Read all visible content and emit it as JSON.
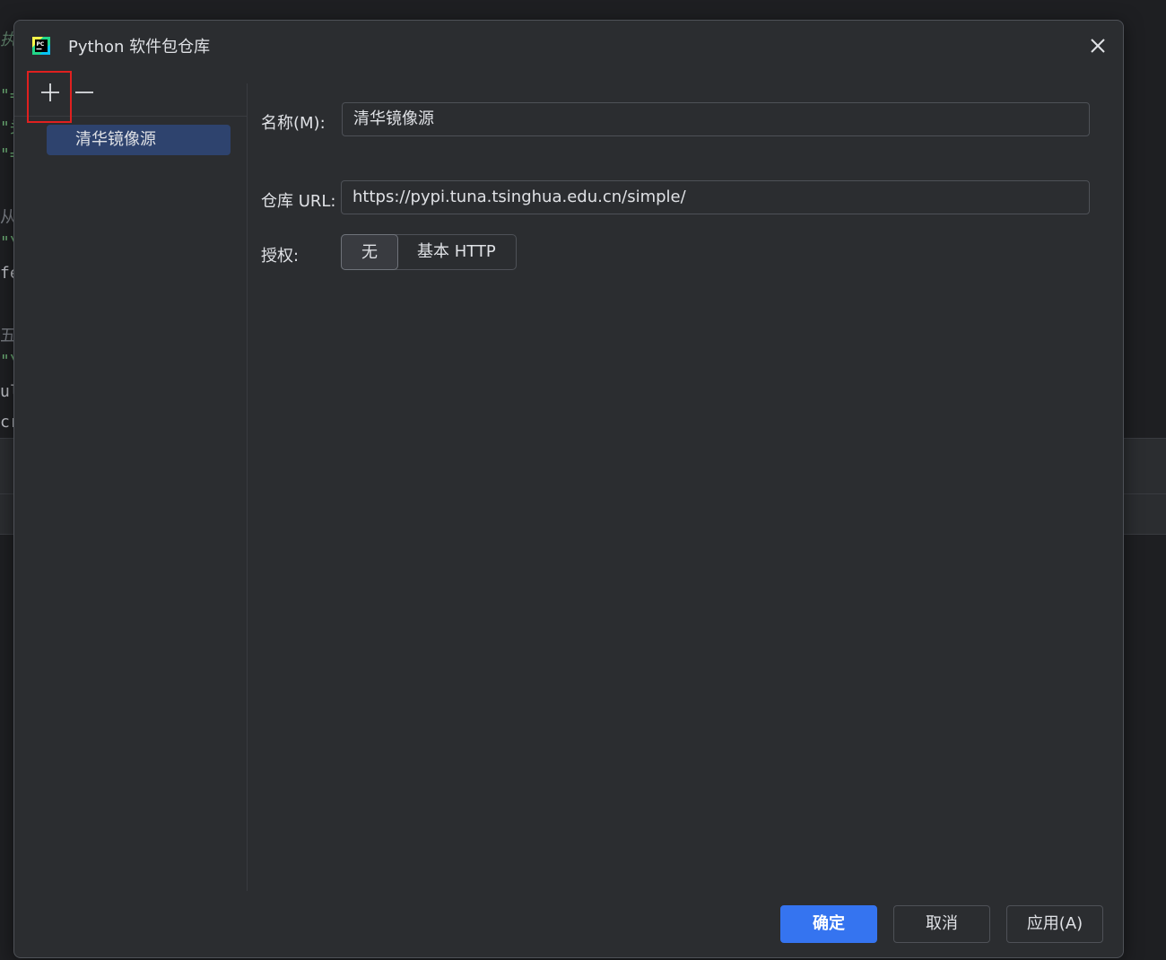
{
  "background": {
    "fragments": [
      {
        "text": "执",
        "color": "#5f826b"
      },
      {
        "text": "\"=",
        "color": "#6aab73"
      },
      {
        "text": "\"头",
        "color": "#6aab73"
      },
      {
        "text": "\"=",
        "color": "#6aab73"
      },
      {
        "text": "从",
        "color": "#7a7e85"
      },
      {
        "text": "\"\\",
        "color": "#6aab73"
      },
      {
        "text": "fe",
        "color": "#bcbec4"
      },
      {
        "text": "五",
        "color": "#7a7e85"
      },
      {
        "text": "\"\\",
        "color": "#6aab73"
      },
      {
        "text": "ul",
        "color": "#bcbec4"
      },
      {
        "text": "cr",
        "color": "#bcbec4"
      }
    ]
  },
  "dialog": {
    "title": "Python 软件包仓库",
    "app_icon": "pycharm-logo-icon",
    "close_icon": "close-icon"
  },
  "toolbar": {
    "add_icon": "plus-icon",
    "remove_icon": "minus-icon"
  },
  "repositories": [
    {
      "name": "清华镜像源",
      "selected": true
    }
  ],
  "form": {
    "name_label": "名称(M):",
    "name_value": "清华镜像源",
    "url_label": "仓库 URL:",
    "url_value": "https://pypi.tuna.tsinghua.edu.cn/simple/",
    "auth_label": "授权:",
    "auth_options": [
      {
        "label": "无",
        "selected": true
      },
      {
        "label": "基本 HTTP",
        "selected": false
      }
    ]
  },
  "footer": {
    "ok_label": "确定",
    "cancel_label": "取消",
    "apply_label": "应用(A)"
  },
  "colors": {
    "accent": "#3574f0",
    "selection": "#2e436e",
    "highlight_box": "#e0201f"
  }
}
